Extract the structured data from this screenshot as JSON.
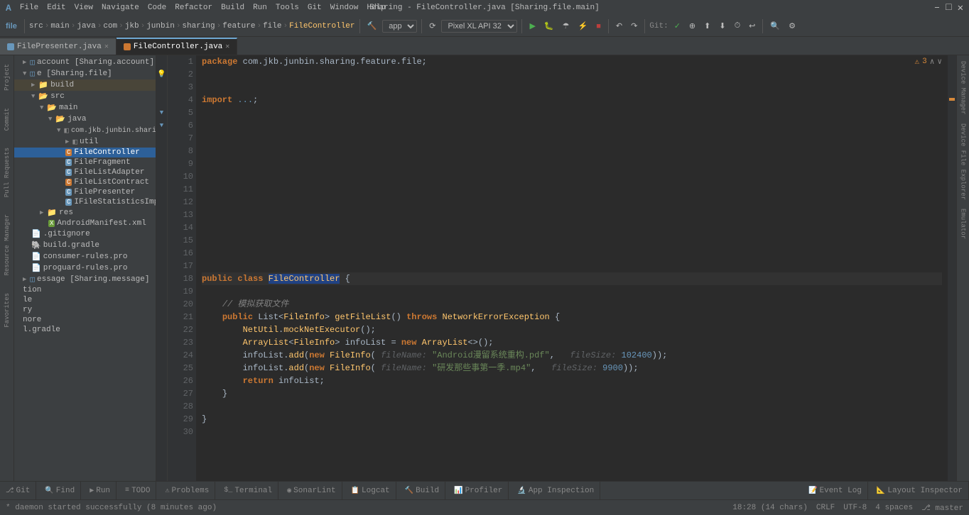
{
  "window": {
    "title": "Sharing - FileController.java [Sharing.file.main]",
    "controls": [
      "–",
      "□",
      "✕"
    ]
  },
  "menu": {
    "items": [
      "File",
      "Edit",
      "View",
      "Navigate",
      "Code",
      "Refactor",
      "Build",
      "Run",
      "Tools",
      "Git",
      "Window",
      "Help"
    ]
  },
  "toolbar": {
    "project_label": "file",
    "breadcrumb": [
      "src",
      "main",
      "java",
      "com",
      "jkb",
      "junbin",
      "sharing",
      "feature",
      "file",
      "FileController"
    ],
    "app_combo": "app ▾",
    "device_combo": "Pixel XL API 32 ▾",
    "git_label": "Git:"
  },
  "tabs": [
    {
      "label": "FilePresenter.java",
      "active": false,
      "type": "java"
    },
    {
      "label": "FileController.java",
      "active": true,
      "type": "java"
    }
  ],
  "project_tree": {
    "items": [
      {
        "label": "account [Sharing.account]",
        "indent": 0,
        "type": "module",
        "expanded": false
      },
      {
        "label": "e [Sharing.file]",
        "indent": 0,
        "type": "module",
        "expanded": true,
        "selected": false
      },
      {
        "label": "build",
        "indent": 1,
        "type": "folder",
        "expanded": false,
        "highlighted": true
      },
      {
        "label": "src",
        "indent": 1,
        "type": "folder",
        "expanded": true
      },
      {
        "label": "main",
        "indent": 2,
        "type": "folder",
        "expanded": true
      },
      {
        "label": "java",
        "indent": 3,
        "type": "folder",
        "expanded": true
      },
      {
        "label": "com.jkb.junbin.shari...",
        "indent": 4,
        "type": "package",
        "expanded": true
      },
      {
        "label": "util",
        "indent": 5,
        "type": "package",
        "expanded": false
      },
      {
        "label": "FileController",
        "indent": 5,
        "type": "java-orange"
      },
      {
        "label": "FileFragment",
        "indent": 5,
        "type": "java"
      },
      {
        "label": "FileListAdapter",
        "indent": 5,
        "type": "java"
      },
      {
        "label": "FileListContract",
        "indent": 5,
        "type": "java-orange"
      },
      {
        "label": "FilePresenter",
        "indent": 5,
        "type": "java"
      },
      {
        "label": "IFileStatisticsImp",
        "indent": 5,
        "type": "java"
      },
      {
        "label": "res",
        "indent": 2,
        "type": "folder",
        "expanded": false
      },
      {
        "label": "AndroidManifest.xml",
        "indent": 3,
        "type": "xml"
      },
      {
        "label": ".gitignore",
        "indent": 1,
        "type": "file"
      },
      {
        "label": "build.gradle",
        "indent": 1,
        "type": "gradle"
      },
      {
        "label": "consumer-rules.pro",
        "indent": 1,
        "type": "file"
      },
      {
        "label": "proguard-rules.pro",
        "indent": 1,
        "type": "file"
      },
      {
        "label": "essage [Sharing.message]",
        "indent": 0,
        "type": "module"
      },
      {
        "label": "tion",
        "indent": 0,
        "type": "item"
      },
      {
        "label": "le",
        "indent": 0,
        "type": "item"
      },
      {
        "label": "ry",
        "indent": 0,
        "type": "item"
      },
      {
        "label": "nore",
        "indent": 0,
        "type": "item"
      },
      {
        "label": "l.gradle",
        "indent": 0,
        "type": "item"
      }
    ]
  },
  "code": {
    "filename": "FileController.java",
    "package": "com.jkb.junbin.sharing.feature.file",
    "lines": [
      {
        "num": 1,
        "content": "package com.jkb.junbin.sharing.feature.file;"
      },
      {
        "num": 2,
        "content": ""
      },
      {
        "num": 3,
        "content": ""
      },
      {
        "num": 4,
        "content": "import ...;"
      },
      {
        "num": 5,
        "content": ""
      },
      {
        "num": 6,
        "content": ""
      },
      {
        "num": 7,
        "content": ""
      },
      {
        "num": 8,
        "content": ""
      },
      {
        "num": 9,
        "content": ""
      },
      {
        "num": 10,
        "content": ""
      },
      {
        "num": 11,
        "content": ""
      },
      {
        "num": 12,
        "content": ""
      },
      {
        "num": 13,
        "content": ""
      },
      {
        "num": 14,
        "content": ""
      },
      {
        "num": 15,
        "content": ""
      },
      {
        "num": 16,
        "content": ""
      },
      {
        "num": 17,
        "content": ""
      },
      {
        "num": 18,
        "content": "public class FileController {",
        "highlighted": true
      },
      {
        "num": 19,
        "content": ""
      },
      {
        "num": 20,
        "content": "    // 模拟获取文件"
      },
      {
        "num": 21,
        "content": "    public List<FileInfo> getFileList() throws NetworkErrorException {"
      },
      {
        "num": 22,
        "content": "        NetUtil.mockNetExecutor();"
      },
      {
        "num": 23,
        "content": "        ArrayList<FileInfo> infoList = new ArrayList<>();"
      },
      {
        "num": 24,
        "content": "        infoList.add(new FileInfo( fileName: \"Android漫留系统重构.pdf\",   fileSize: 102400));"
      },
      {
        "num": 25,
        "content": "        infoList.add(new FileInfo( fileName: \"研发那些事第一季.mp4\",   fileSize: 9900));"
      },
      {
        "num": 26,
        "content": "        return infoList;"
      },
      {
        "num": 27,
        "content": "    }"
      },
      {
        "num": 28,
        "content": ""
      },
      {
        "num": 29,
        "content": "}"
      },
      {
        "num": 30,
        "content": ""
      }
    ]
  },
  "bottom_tabs": [
    {
      "label": "Git",
      "icon": "⎇",
      "active": false
    },
    {
      "label": "Find",
      "icon": "🔍",
      "active": false
    },
    {
      "label": "Run",
      "icon": "▶",
      "active": false
    },
    {
      "label": "TODO",
      "icon": "≡",
      "active": false
    },
    {
      "label": "Problems",
      "icon": "⚠",
      "active": false
    },
    {
      "label": "Terminal",
      "icon": "$",
      "active": false
    },
    {
      "label": "SonarLint",
      "icon": "◉",
      "active": false
    },
    {
      "label": "Logcat",
      "icon": "📋",
      "active": false
    },
    {
      "label": "Build",
      "icon": "🔨",
      "active": false
    },
    {
      "label": "Profiler",
      "icon": "📊",
      "active": false
    },
    {
      "label": "App Inspection",
      "icon": "🔬",
      "active": false
    },
    {
      "label": "Event Log",
      "icon": "📝",
      "active": false
    },
    {
      "label": "Layout Inspector",
      "icon": "📐",
      "active": false
    }
  ],
  "status_bar": {
    "notification": "* daemon started successfully (8 minutes ago)",
    "position": "18:28 (14 chars)",
    "line_ending": "CRLF",
    "encoding": "UTF-8",
    "indent": "4 spaces",
    "branch": "master"
  },
  "right_panels": [
    "Device Manager",
    "Device File Explorer",
    "Emulator"
  ],
  "left_panels": [
    "Project",
    "Commit",
    "Pull Requests",
    "Resource Manager",
    "Favorites"
  ],
  "warnings": {
    "count": "3",
    "icon": "⚠"
  }
}
